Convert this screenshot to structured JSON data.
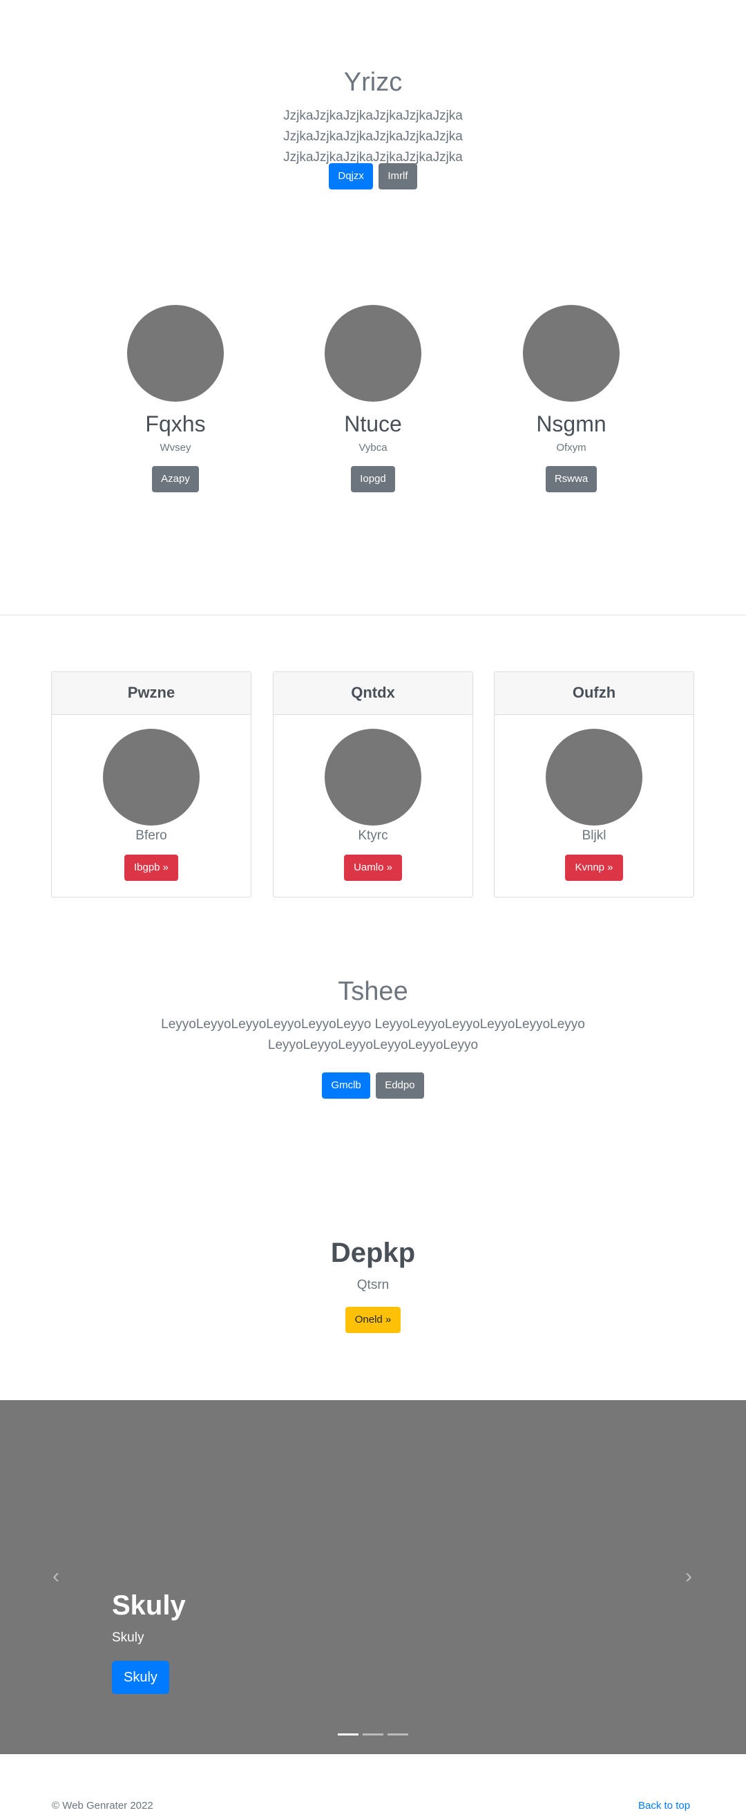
{
  "hero1": {
    "title": "Yrizc",
    "lead": "JzjkaJzjkaJzjkaJzjkaJzjkaJzjka JzjkaJzjkaJzjkaJzjkaJzjkaJzjka JzjkaJzjkaJzjkaJzjkaJzjkaJzjka",
    "primary_label": "Dqjzx",
    "secondary_label": "Imrlf"
  },
  "people": [
    {
      "name": "Fqxhs",
      "role": "Wvsey",
      "button": "Azapy"
    },
    {
      "name": "Ntuce",
      "role": "Vybca",
      "button": "Iopgd"
    },
    {
      "name": "Nsgmn",
      "role": "Ofxym",
      "button": "Rswwa"
    }
  ],
  "cards": [
    {
      "header": "Pwzne",
      "text": "Bfero",
      "button": "Ibgpb »"
    },
    {
      "header": "Qntdx",
      "text": "Ktyrc",
      "button": "Uamlo »"
    },
    {
      "header": "Oufzh",
      "text": "Bljkl",
      "button": "Kvnnp »"
    }
  ],
  "hero2": {
    "title": "Tshee",
    "lead": "LeyyoLeyyoLeyyoLeyyoLeyyoLeyyo LeyyoLeyyoLeyyoLeyyoLeyyoLeyyo LeyyoLeyyoLeyyoLeyyoLeyyoLeyyo",
    "primary_label": "Gmclb",
    "secondary_label": "Eddpo"
  },
  "section5": {
    "title": "Depkp",
    "subtitle": "Qtsrn",
    "button": "Oneld »"
  },
  "carousel": {
    "prev_icon": "chevron-left-icon",
    "next_icon": "chevron-right-icon",
    "caption_title": "Skuly",
    "caption_text": "Skuly",
    "caption_button": "Skuly",
    "slides_count": 3,
    "active_index": 0
  },
  "footer": {
    "copyright": "© Web Genrater 2022",
    "back_to_top": "Back to top"
  },
  "colors": {
    "primary": "#007bff",
    "secondary": "#6c757d",
    "danger": "#dc3545",
    "warning": "#ffc107",
    "placeholder": "#777777"
  }
}
